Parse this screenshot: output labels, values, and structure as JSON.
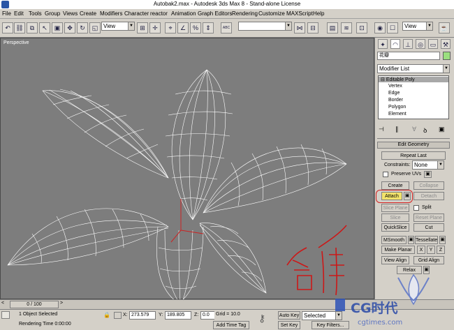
{
  "window": {
    "title": "Autobak2.max - Autodesk 3ds Max 8 - Stand-alone License"
  },
  "menu": [
    "File",
    "Edit",
    "Tools",
    "Group",
    "Views",
    "Create",
    "Modifiers",
    "Character",
    "reactor",
    "Animation",
    "Graph Editors",
    "Rendering",
    "Customize",
    "MAXScript",
    "Help"
  ],
  "toolbar": {
    "ref_coord": "View",
    "named_selection": "",
    "view_combo": "View",
    "abc_label": "ABC"
  },
  "viewport": {
    "label": "Perspective",
    "annotation": "合并"
  },
  "panel": {
    "object_name": "花瓣",
    "modifier_list": "Modifier List",
    "stack": {
      "root": "Editable Poly",
      "items": [
        "Vertex",
        "Edge",
        "Border",
        "Polygon",
        "Element"
      ]
    },
    "rollout_title": "Edit Geometry",
    "repeat_last": "Repeat Last",
    "constraints_label": "Constraints:",
    "constraints_value": "None",
    "preserve_uvs": "Preserve UVs",
    "create": "Create",
    "collapse": "Collapse",
    "attach": "Attach",
    "detach": "Detach",
    "slice_plane": "Slice Plane",
    "split": "Split",
    "slice": "Slice",
    "reset_plane": "Reset Plane",
    "quickslice": "QuickSlice",
    "cut": "Cut",
    "msmooth": "MSmooth",
    "tessellate": "Tessellate",
    "make_planar": "Make Planar",
    "x": "X",
    "y": "Y",
    "z": "Z",
    "view_align": "View Align",
    "grid_align": "Grid Align",
    "relax": "Relax"
  },
  "timeline": {
    "frame": "0 / 100"
  },
  "status": {
    "selected": "1 Object Selected",
    "render_time": "Rendering Time  0:00:00",
    "x_label": "X:",
    "x_value": "273.579",
    "y_label": "Y:",
    "y_value": "189.805",
    "z_label": "Z:",
    "z_value": "0.0",
    "grid": "Grid = 10.0",
    "add_time_tag": "Add Time Tag",
    "auto_key": "Auto Key",
    "selected_dd": "Selected",
    "set_key": "Set Key",
    "key_filters": "Key Filters..."
  },
  "watermark": {
    "line1": "CG时代",
    "line2": "cgtimes.com"
  }
}
